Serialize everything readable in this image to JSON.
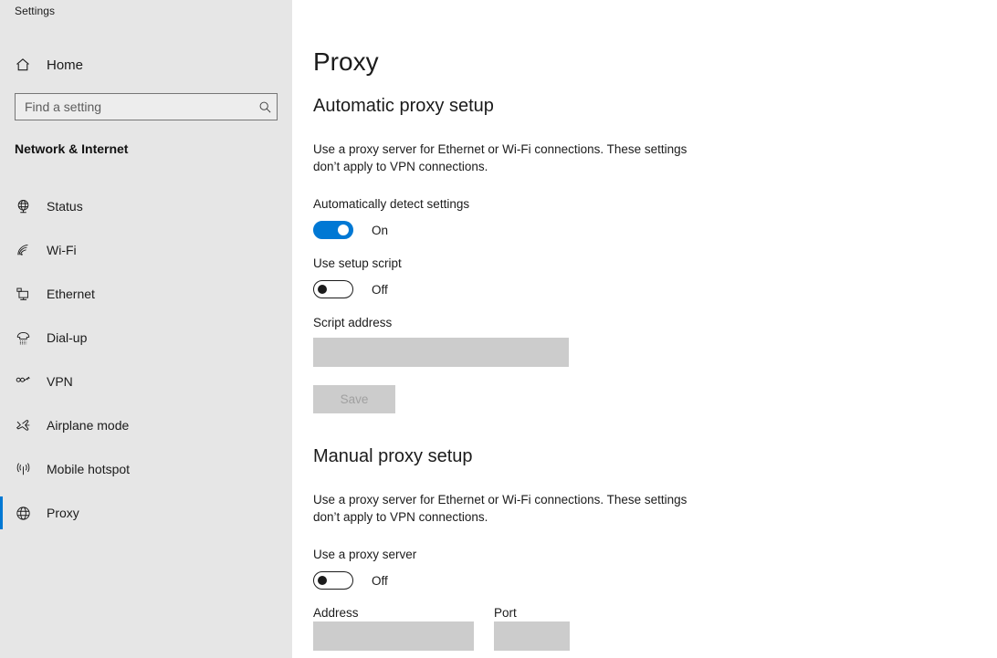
{
  "window": {
    "title": "Settings"
  },
  "sidebar": {
    "home": {
      "label": "Home",
      "icon": "home-icon"
    },
    "search": {
      "placeholder": "Find a setting",
      "value": "",
      "icon": "search-icon"
    },
    "group_header": "Network & Internet",
    "items": [
      {
        "label": "Status",
        "icon": "status-globe-icon",
        "selected": false
      },
      {
        "label": "Wi-Fi",
        "icon": "wifi-icon",
        "selected": false
      },
      {
        "label": "Ethernet",
        "icon": "ethernet-icon",
        "selected": false
      },
      {
        "label": "Dial-up",
        "icon": "dialup-phone-icon",
        "selected": false
      },
      {
        "label": "VPN",
        "icon": "vpn-key-icon",
        "selected": false
      },
      {
        "label": "Airplane mode",
        "icon": "airplane-icon",
        "selected": false
      },
      {
        "label": "Mobile hotspot",
        "icon": "hotspot-icon",
        "selected": false
      },
      {
        "label": "Proxy",
        "icon": "globe-icon",
        "selected": true
      }
    ]
  },
  "main": {
    "page_title": "Proxy",
    "automatic": {
      "section_title": "Automatic proxy setup",
      "description": "Use a proxy server for Ethernet or Wi-Fi connections. These settings don’t apply to VPN connections.",
      "auto_detect": {
        "label": "Automatically detect settings",
        "state": "On",
        "on": true
      },
      "setup_script": {
        "label": "Use setup script",
        "state": "Off",
        "on": false
      },
      "script_address": {
        "label": "Script address",
        "value": "",
        "disabled": true
      },
      "save_label": "Save"
    },
    "manual": {
      "section_title": "Manual proxy setup",
      "description": "Use a proxy server for Ethernet or Wi-Fi connections. These settings don’t apply to VPN connections.",
      "use_proxy": {
        "label": "Use a proxy server",
        "state": "Off",
        "on": false
      },
      "address": {
        "label": "Address",
        "value": "",
        "disabled": true
      },
      "port": {
        "label": "Port",
        "value": "",
        "disabled": true
      }
    }
  },
  "colors": {
    "accent": "#0078d4",
    "sidebar_bg": "#e6e6e6",
    "disabled_field": "#cccccc",
    "text": "#1b1b1b"
  }
}
